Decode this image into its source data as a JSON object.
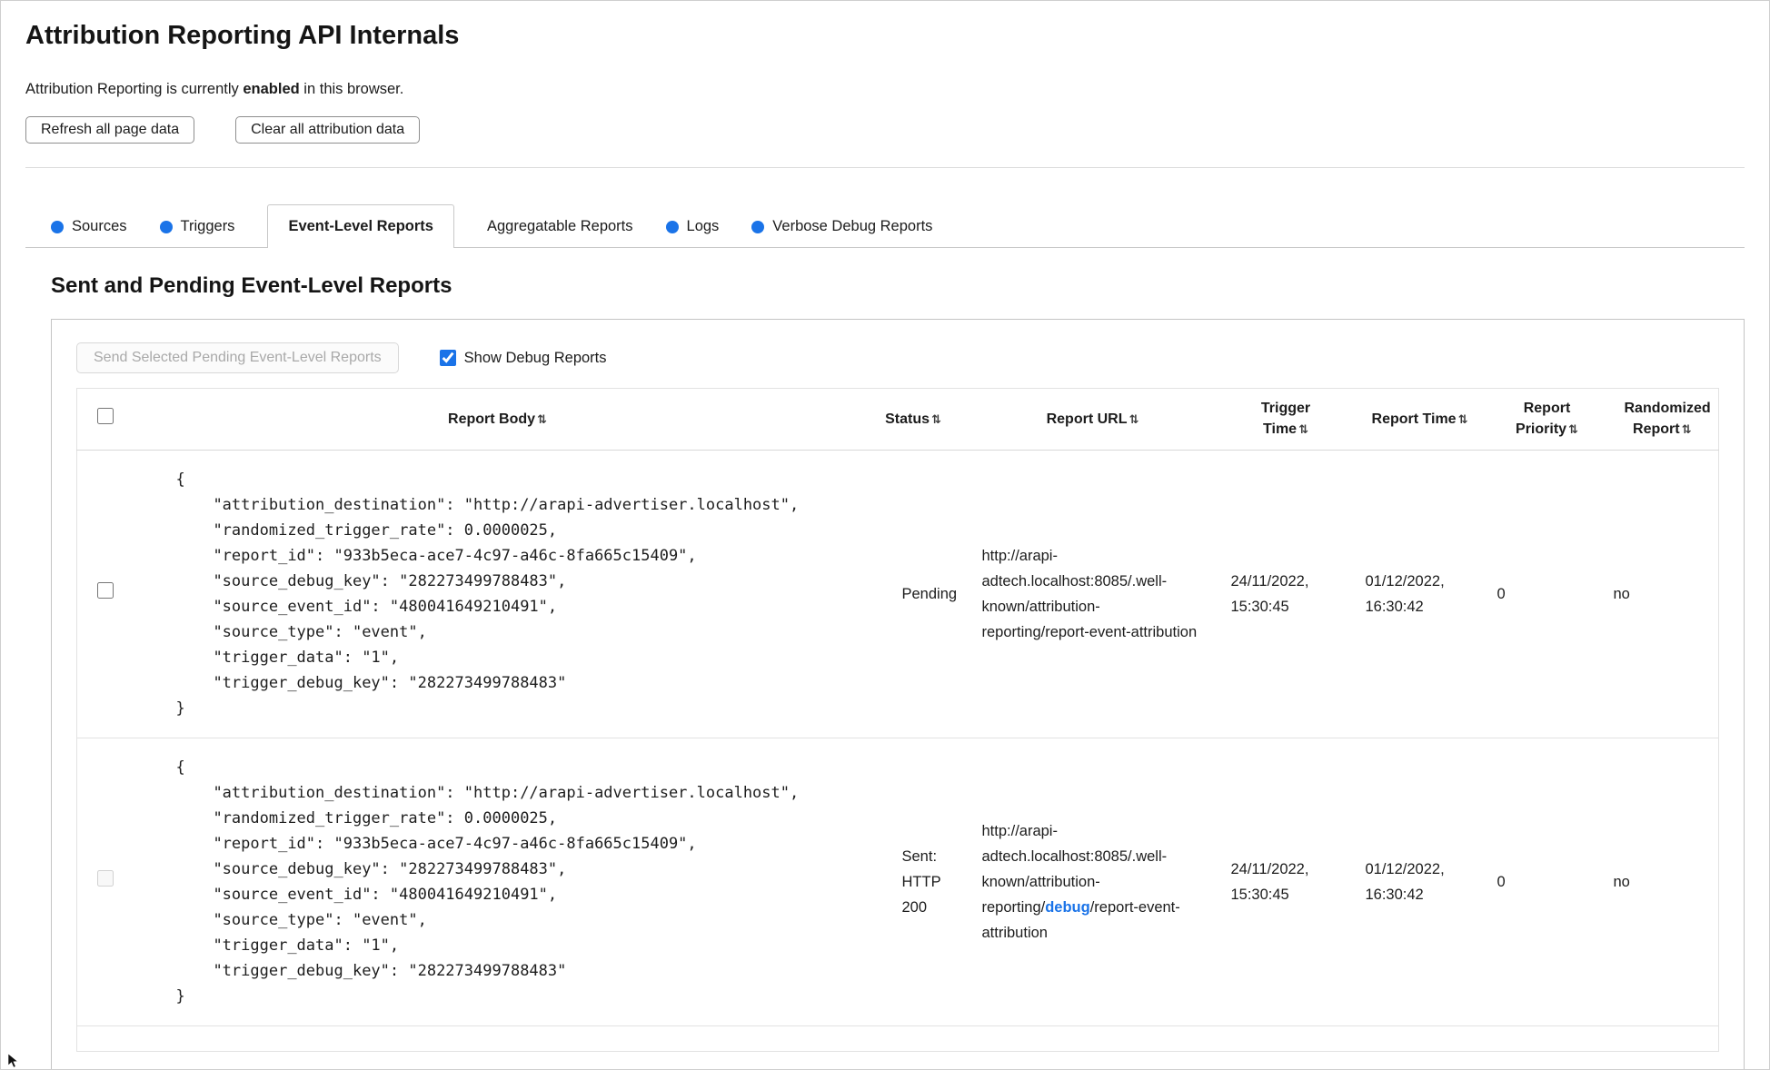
{
  "colors": {
    "accent_blue": "#1a73e8",
    "border_gray": "#c8c8c8"
  },
  "icons": {
    "sort_indicator": "⇅",
    "status_dot": "●"
  },
  "header": {
    "title": "Attribution Reporting API Internals",
    "status": {
      "prefix": "Attribution Reporting is currently ",
      "emphasis": "enabled",
      "suffix": " in this browser."
    },
    "refresh_button": "Refresh all page data",
    "clear_button": "Clear all attribution data"
  },
  "tabs": [
    {
      "label": "Sources"
    },
    {
      "label": "Triggers"
    },
    {
      "label": "Event-Level Reports"
    },
    {
      "label": "Aggregatable Reports"
    },
    {
      "label": "Logs"
    },
    {
      "label": "Verbose Debug Reports"
    }
  ],
  "section": {
    "title": "Sent and Pending Event-Level Reports",
    "send_button": "Send Selected Pending Event-Level Reports",
    "send_button_disabled": true,
    "show_debug_label": "Show Debug Reports",
    "show_debug_checked": true
  },
  "table": {
    "headers": [
      "Report Body",
      "Status",
      "Report URL",
      "Trigger Time",
      "Report Time",
      "Report Priority",
      "Randomized Report"
    ],
    "rows": [
      {
        "report_body": "{\n    \"attribution_destination\": \"http://arapi-advertiser.localhost\",\n    \"randomized_trigger_rate\": 0.0000025,\n    \"report_id\": \"933b5eca-ace7-4c97-a46c-8fa665c15409\",\n    \"source_debug_key\": \"282273499788483\",\n    \"source_event_id\": \"480041649210491\",\n    \"source_type\": \"event\",\n    \"trigger_data\": \"1\",\n    \"trigger_debug_key\": \"282273499788483\"\n}",
        "status": "Pending",
        "url_prefix": "http://arapi-adtech.localhost:8085/.well-known/attribution-reporting/report-event-attribution",
        "url_debug": "",
        "url_suffix": "",
        "trigger_time": "24/11/2022, 15:30:45",
        "report_time": "01/12/2022, 16:30:42",
        "report_priority": "0",
        "randomized_report": "no"
      },
      {
        "report_body": "{\n    \"attribution_destination\": \"http://arapi-advertiser.localhost\",\n    \"randomized_trigger_rate\": 0.0000025,\n    \"report_id\": \"933b5eca-ace7-4c97-a46c-8fa665c15409\",\n    \"source_debug_key\": \"282273499788483\",\n    \"source_event_id\": \"480041649210491\",\n    \"source_type\": \"event\",\n    \"trigger_data\": \"1\",\n    \"trigger_debug_key\": \"282273499788483\"\n}",
        "status": "Sent: HTTP 200",
        "url_prefix": "http://arapi-adtech.localhost:8085/.well-known/attribution-reporting/",
        "url_debug": "debug",
        "url_suffix": "/report-event-attribution",
        "trigger_time": "24/11/2022, 15:30:45",
        "report_time": "01/12/2022, 16:30:42",
        "report_priority": "0",
        "randomized_report": "no",
        "checkbox_disabled": true
      }
    ]
  }
}
